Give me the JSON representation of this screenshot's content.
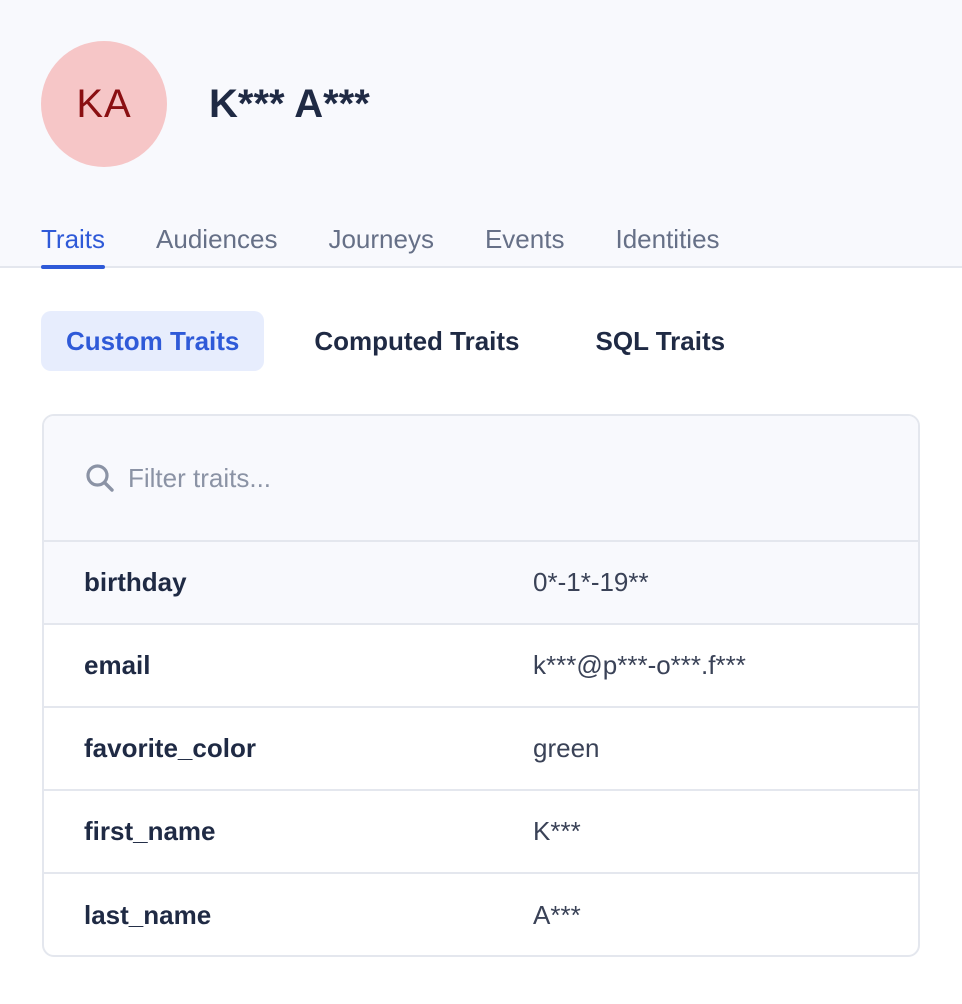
{
  "profile": {
    "initials": "KA",
    "name": "K*** A***"
  },
  "tabs": [
    {
      "label": "Traits",
      "active": true
    },
    {
      "label": "Audiences",
      "active": false
    },
    {
      "label": "Journeys",
      "active": false
    },
    {
      "label": "Events",
      "active": false
    },
    {
      "label": "Identities",
      "active": false
    }
  ],
  "subtabs": [
    {
      "label": "Custom Traits",
      "active": true
    },
    {
      "label": "Computed Traits",
      "active": false
    },
    {
      "label": "SQL Traits",
      "active": false
    }
  ],
  "search": {
    "placeholder": "Filter traits...",
    "value": "",
    "icon": "search-icon"
  },
  "traits": [
    {
      "key": "birthday",
      "value": "0*-1*-19**"
    },
    {
      "key": "email",
      "value": "k***@p***-o***.f***"
    },
    {
      "key": "favorite_color",
      "value": "green"
    },
    {
      "key": "first_name",
      "value": "K***"
    },
    {
      "key": "last_name",
      "value": "A***"
    }
  ],
  "colors": {
    "accent": "#2f5ad8",
    "avatar_bg": "#f6c6c7",
    "avatar_text": "#8a0f12",
    "header_bg": "#f8f9fd"
  }
}
